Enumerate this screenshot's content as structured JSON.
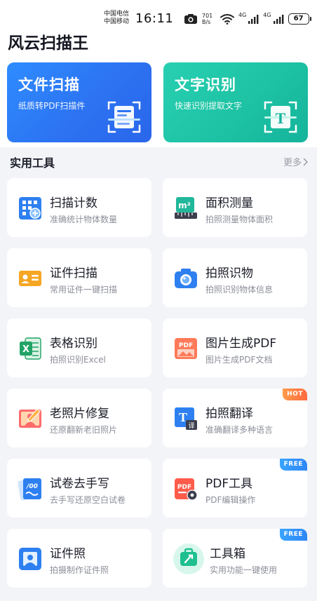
{
  "status_bar": {
    "carrier_1": "中国电信",
    "carrier_2": "中国移动",
    "time": "16:11",
    "speed_value": "701",
    "speed_unit": "B/s",
    "net_1": "4G",
    "net_2": "4G",
    "battery": "67"
  },
  "app": {
    "title": "风云扫描王"
  },
  "hero": {
    "scan": {
      "title": "文件扫描",
      "subtitle": "纸质转PDF扫描件",
      "color": "#2c73f2"
    },
    "ocr": {
      "title": "文字识别",
      "subtitle": "快速识别提取文字",
      "color": "#1ec2a4",
      "icon_glyph": "T"
    }
  },
  "section": {
    "title": "实用工具",
    "more": "更多"
  },
  "tools": [
    {
      "name": "扫描计数",
      "desc": "准确统计物体数量",
      "icon": "grid-count-icon"
    },
    {
      "name": "面积测量",
      "desc": "拍照测量物体面积",
      "icon": "ruler-area-icon",
      "icon_text": "m²"
    },
    {
      "name": "证件扫描",
      "desc": "常用证件一键扫描",
      "icon": "id-card-icon"
    },
    {
      "name": "拍照识物",
      "desc": "拍照识别物体信息",
      "icon": "camera-icon"
    },
    {
      "name": "表格识别",
      "desc": "拍照识别Excel",
      "icon": "excel-icon",
      "icon_text": "X"
    },
    {
      "name": "图片生成PDF",
      "desc": "图片生成PDF文档",
      "icon": "image-pdf-icon",
      "icon_text": "PDF"
    },
    {
      "name": "老照片修复",
      "desc": "还原翻新老旧照片",
      "icon": "photo-restore-icon"
    },
    {
      "name": "拍照翻译",
      "desc": "准确翻译多种语言",
      "icon": "translate-icon",
      "badge": "HOT",
      "icon_text": "T",
      "icon_sub": "译"
    },
    {
      "name": "试卷去手写",
      "desc": "去手写还原空白试卷",
      "icon": "exam-paper-icon",
      "icon_text": "/00"
    },
    {
      "name": "PDF工具",
      "desc": "PDF编辑操作",
      "icon": "pdf-tools-icon",
      "badge": "FREE",
      "icon_text": "PDF"
    },
    {
      "name": "证件照",
      "desc": "拍摄制作证件照",
      "icon": "id-photo-icon"
    },
    {
      "name": "工具箱",
      "desc": "实用功能一键使用",
      "icon": "toolbox-icon",
      "badge": "FREE"
    }
  ]
}
